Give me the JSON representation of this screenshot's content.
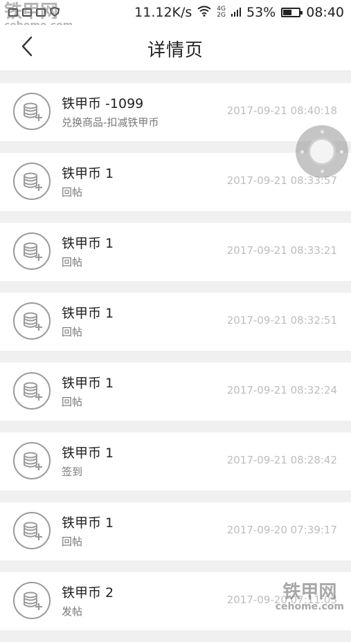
{
  "status_bar": {
    "speed": "11.12K/s",
    "network_top": "4G",
    "network_bottom": "2G",
    "battery": "53%",
    "battery_level": 0.53,
    "time": "08:40"
  },
  "watermark": {
    "brand": "铁甲网",
    "domain": "cehome.com"
  },
  "nav": {
    "title": "详情页",
    "back_icon": "chevron-left-icon"
  },
  "records": [
    {
      "amount": "铁甲币 -1099",
      "desc": "兑换商品-扣减铁甲币",
      "time": "2017-09-21 08:40:18"
    },
    {
      "amount": "铁甲币 1",
      "desc": "回帖",
      "time": "2017-09-21 08:33:57"
    },
    {
      "amount": "铁甲币 1",
      "desc": "回帖",
      "time": "2017-09-21 08:33:21"
    },
    {
      "amount": "铁甲币 1",
      "desc": "回帖",
      "time": "2017-09-21 08:32:51"
    },
    {
      "amount": "铁甲币 1",
      "desc": "回帖",
      "time": "2017-09-21 08:32:24"
    },
    {
      "amount": "铁甲币 1",
      "desc": "签到",
      "time": "2017-09-21 08:28:42"
    },
    {
      "amount": "铁甲币 1",
      "desc": "回帖",
      "time": "2017-09-20 07:39:17"
    },
    {
      "amount": "铁甲币 2",
      "desc": "发帖",
      "time": "2017-09-20 07:11:03"
    }
  ],
  "colors": {
    "background": "#f0f0f0",
    "card": "#ffffff",
    "icon_stroke": "#9a9a9a",
    "muted_text": "#777777",
    "time_text": "#bdbdbd"
  }
}
